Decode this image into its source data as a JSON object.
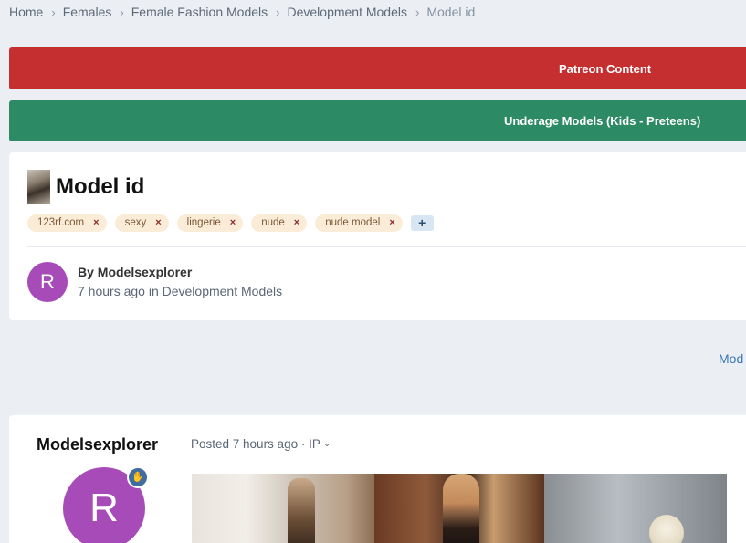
{
  "breadcrumb": {
    "items": [
      "Home",
      "Females",
      "Female Fashion Models",
      "Development Models",
      "Model id"
    ],
    "separator": ">"
  },
  "banners": {
    "patreon": "Patreon Content",
    "underage": "Underage Models (Kids - Preteens)"
  },
  "topic": {
    "title": "Model id",
    "tags": [
      {
        "label": "123rf.com",
        "remove": "×"
      },
      {
        "label": "sexy",
        "remove": "×"
      },
      {
        "label": "lingerie",
        "remove": "×"
      },
      {
        "label": "nude",
        "remove": "×"
      },
      {
        "label": "nude model",
        "remove": "×"
      }
    ],
    "add_tag": "+",
    "author": {
      "avatar_letter": "R",
      "by_line": "By Modelsexplorer",
      "meta": "7 hours ago in Development Models"
    }
  },
  "mod_link": "Mod",
  "post": {
    "poster_name": "Modelsexplorer",
    "posted_meta": "Posted 7 hours ago · IP",
    "avatar_letter": "R",
    "badge_icon": "hand-icon"
  },
  "colors": {
    "patreon_banner": "#c62f2f",
    "underage_banner": "#2c8a64",
    "avatar": "#a64bb8",
    "tag_bg": "#fbecd8",
    "link": "#3a76b8"
  }
}
